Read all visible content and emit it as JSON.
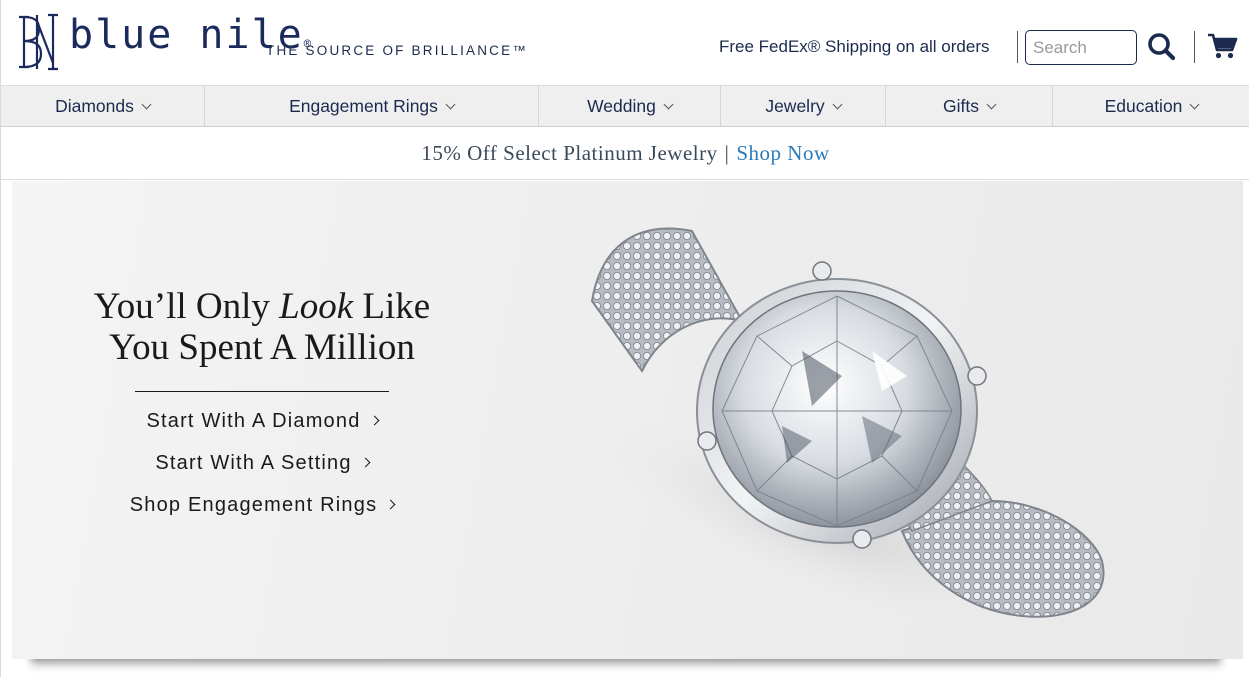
{
  "header": {
    "brand": "blue nile",
    "brand_dot": "®",
    "tagline": "THE SOURCE OF BRILLIANCE™",
    "shipping_text": "Free FedEx® Shipping on all orders",
    "search_placeholder": "Search",
    "search_icon": "search-icon",
    "cart_icon": "cart-icon"
  },
  "nav": {
    "items": [
      {
        "label": "Diamonds"
      },
      {
        "label": "Engagement Rings"
      },
      {
        "label": "Wedding"
      },
      {
        "label": "Jewelry"
      },
      {
        "label": "Gifts"
      },
      {
        "label": "Education"
      }
    ]
  },
  "promo": {
    "text": "15% Off Select Platinum Jewelry",
    "separator": "|",
    "link": "Shop Now"
  },
  "hero": {
    "headline_part1": "You’ll Only ",
    "headline_italic": "Look",
    "headline_part2": " Like",
    "headline_line2": "You Spent A Million",
    "ctas": [
      {
        "label": "Start With A Diamond"
      },
      {
        "label": "Start With A Setting"
      },
      {
        "label": "Shop Engagement Rings"
      }
    ]
  },
  "colors": {
    "brand_navy": "#1b2a5c",
    "link_blue": "#2a7ab8",
    "nav_bg": "#efefef"
  }
}
